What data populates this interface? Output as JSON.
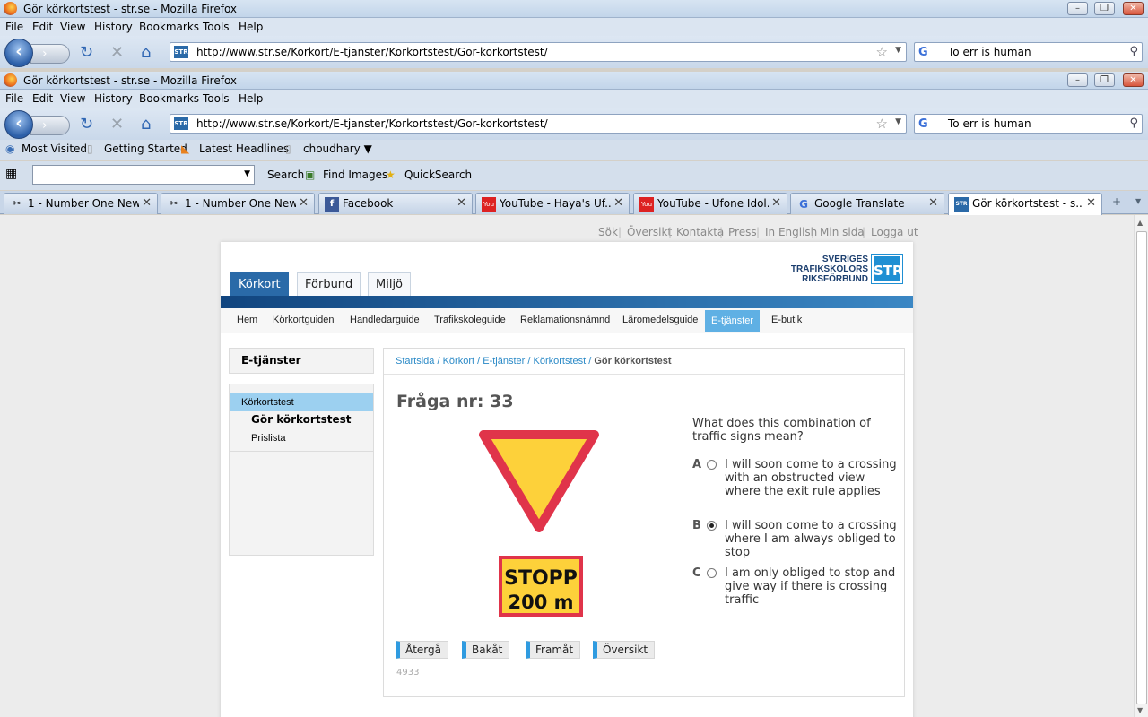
{
  "window": {
    "title": "Gör körkortstest - str.se - Mozilla Firefox",
    "controls": [
      "–",
      "❐",
      "✕"
    ]
  },
  "menu": [
    "File",
    "Edit",
    "View",
    "History",
    "Bookmarks",
    "Tools",
    "Help"
  ],
  "address": {
    "url": "http://www.str.se/Korkort/E-tjanster/Korkortstest/Gor-korkortstest/",
    "favicon": "STR"
  },
  "search": {
    "value": "To err is human"
  },
  "bookmarks": [
    "Most Visited",
    "Getting Started",
    "Latest Headlines",
    "choudhary ▼"
  ],
  "toolbar2": {
    "search_label": "Search",
    "find_images": "Find Images",
    "quicksearch": "QuickSearch"
  },
  "tabs": [
    {
      "label": "1 - Number One New...",
      "icon": "clip-icon"
    },
    {
      "label": "1 - Number One New...",
      "icon": "clip-icon"
    },
    {
      "label": "Facebook",
      "icon": "facebook-icon"
    },
    {
      "label": "YouTube - Haya's Uf...",
      "icon": "youtube-icon"
    },
    {
      "label": "YouTube - Ufone Idol...",
      "icon": "youtube-icon"
    },
    {
      "label": "Google Translate",
      "icon": "google-icon"
    },
    {
      "label": "Gör körkortstest - s...",
      "icon": "str-icon"
    }
  ],
  "site": {
    "top_links": [
      "Sök",
      "Översikt",
      "Kontakta",
      "Press",
      "In English",
      "Min sida",
      "Logga ut"
    ],
    "logo_lines": [
      "SVERIGES",
      "TRAFIKSKOLORS",
      "RIKSFÖRBUND"
    ],
    "logo_box": "STR",
    "main_tabs": [
      "Körkort",
      "Förbund",
      "Miljö"
    ],
    "sub_nav": [
      "Hem",
      "Körkortguiden",
      "Handledarguide",
      "Trafikskoleguide",
      "Reklamationsnämnd",
      "Läromedelsguide",
      "E-tjänster",
      "E-butik"
    ],
    "sidebar": {
      "heading": "E-tjänster",
      "items": [
        "Körkortstest",
        "Gör körkortstest",
        "Prislista"
      ]
    },
    "breadcrumb": [
      "Startsida",
      "Körkort",
      "E-tjänster",
      "Körkortstest"
    ],
    "breadcrumb_current": "Gör körkortstest",
    "question_title": "Fråga nr: 33",
    "sign_text": [
      "STOPP",
      "200 m"
    ],
    "question": "What does this combination of traffic signs mean?",
    "options": [
      {
        "letter": "A",
        "text": "I will soon come to a crossing with an obstructed view where the exit rule applies",
        "selected": false
      },
      {
        "letter": "B",
        "text": "I will soon come to a crossing where I am always obliged to stop",
        "selected": true
      },
      {
        "letter": "C",
        "text": "I am only obliged to stop and give way if there is crossing traffic",
        "selected": false
      }
    ],
    "buttons": [
      "Återgå",
      "Bakåt",
      "Framåt",
      "Översikt"
    ],
    "code": "4933"
  },
  "colors": {
    "accent": "#2f9be0",
    "site_blue": "#2a6aa8",
    "sign_red": "#e0344a",
    "sign_yellow": "#fdd13a"
  }
}
